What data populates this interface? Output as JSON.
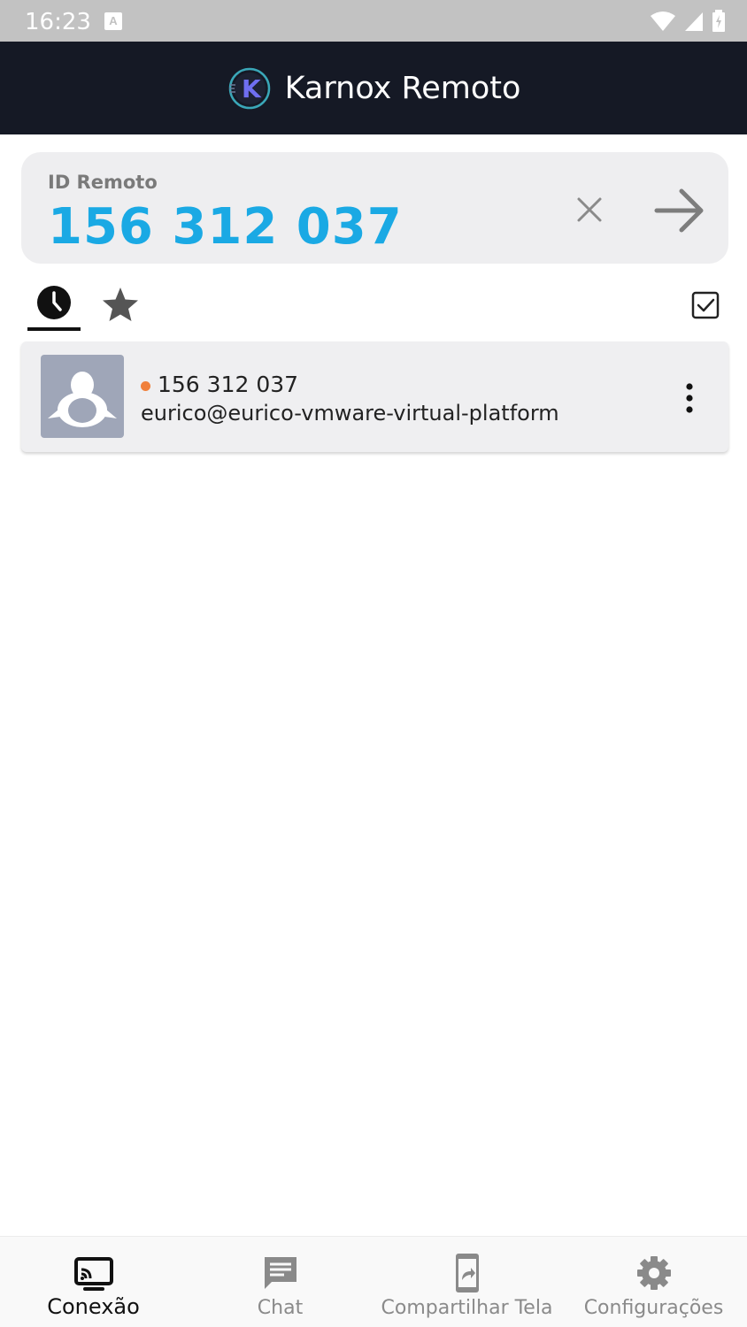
{
  "status_bar": {
    "time": "16:23",
    "notification_icon": "A"
  },
  "app_bar": {
    "title": "Karnox Remoto",
    "logo_letter": "K"
  },
  "remote": {
    "label": "ID Remoto",
    "value": "156 312 037",
    "accent_color": "#1aa9e4"
  },
  "tabs": [
    {
      "name": "recent",
      "icon": "clock-icon",
      "active": true
    },
    {
      "name": "favorites",
      "icon": "star-icon",
      "active": false
    }
  ],
  "peers": [
    {
      "id": "156 312 037",
      "host": "eurico@eurico-vmware-virtual-platform",
      "os_icon": "linux-penguin-icon",
      "status_color": "#f0803c"
    }
  ],
  "bottom_nav": [
    {
      "label": "Conexão",
      "icon": "cast-icon",
      "active": true
    },
    {
      "label": "Chat",
      "icon": "chat-icon",
      "active": false
    },
    {
      "label": "Compartilhar Tela",
      "icon": "share-screen-icon",
      "active": false
    },
    {
      "label": "Configurações",
      "icon": "gear-icon",
      "active": false
    }
  ]
}
